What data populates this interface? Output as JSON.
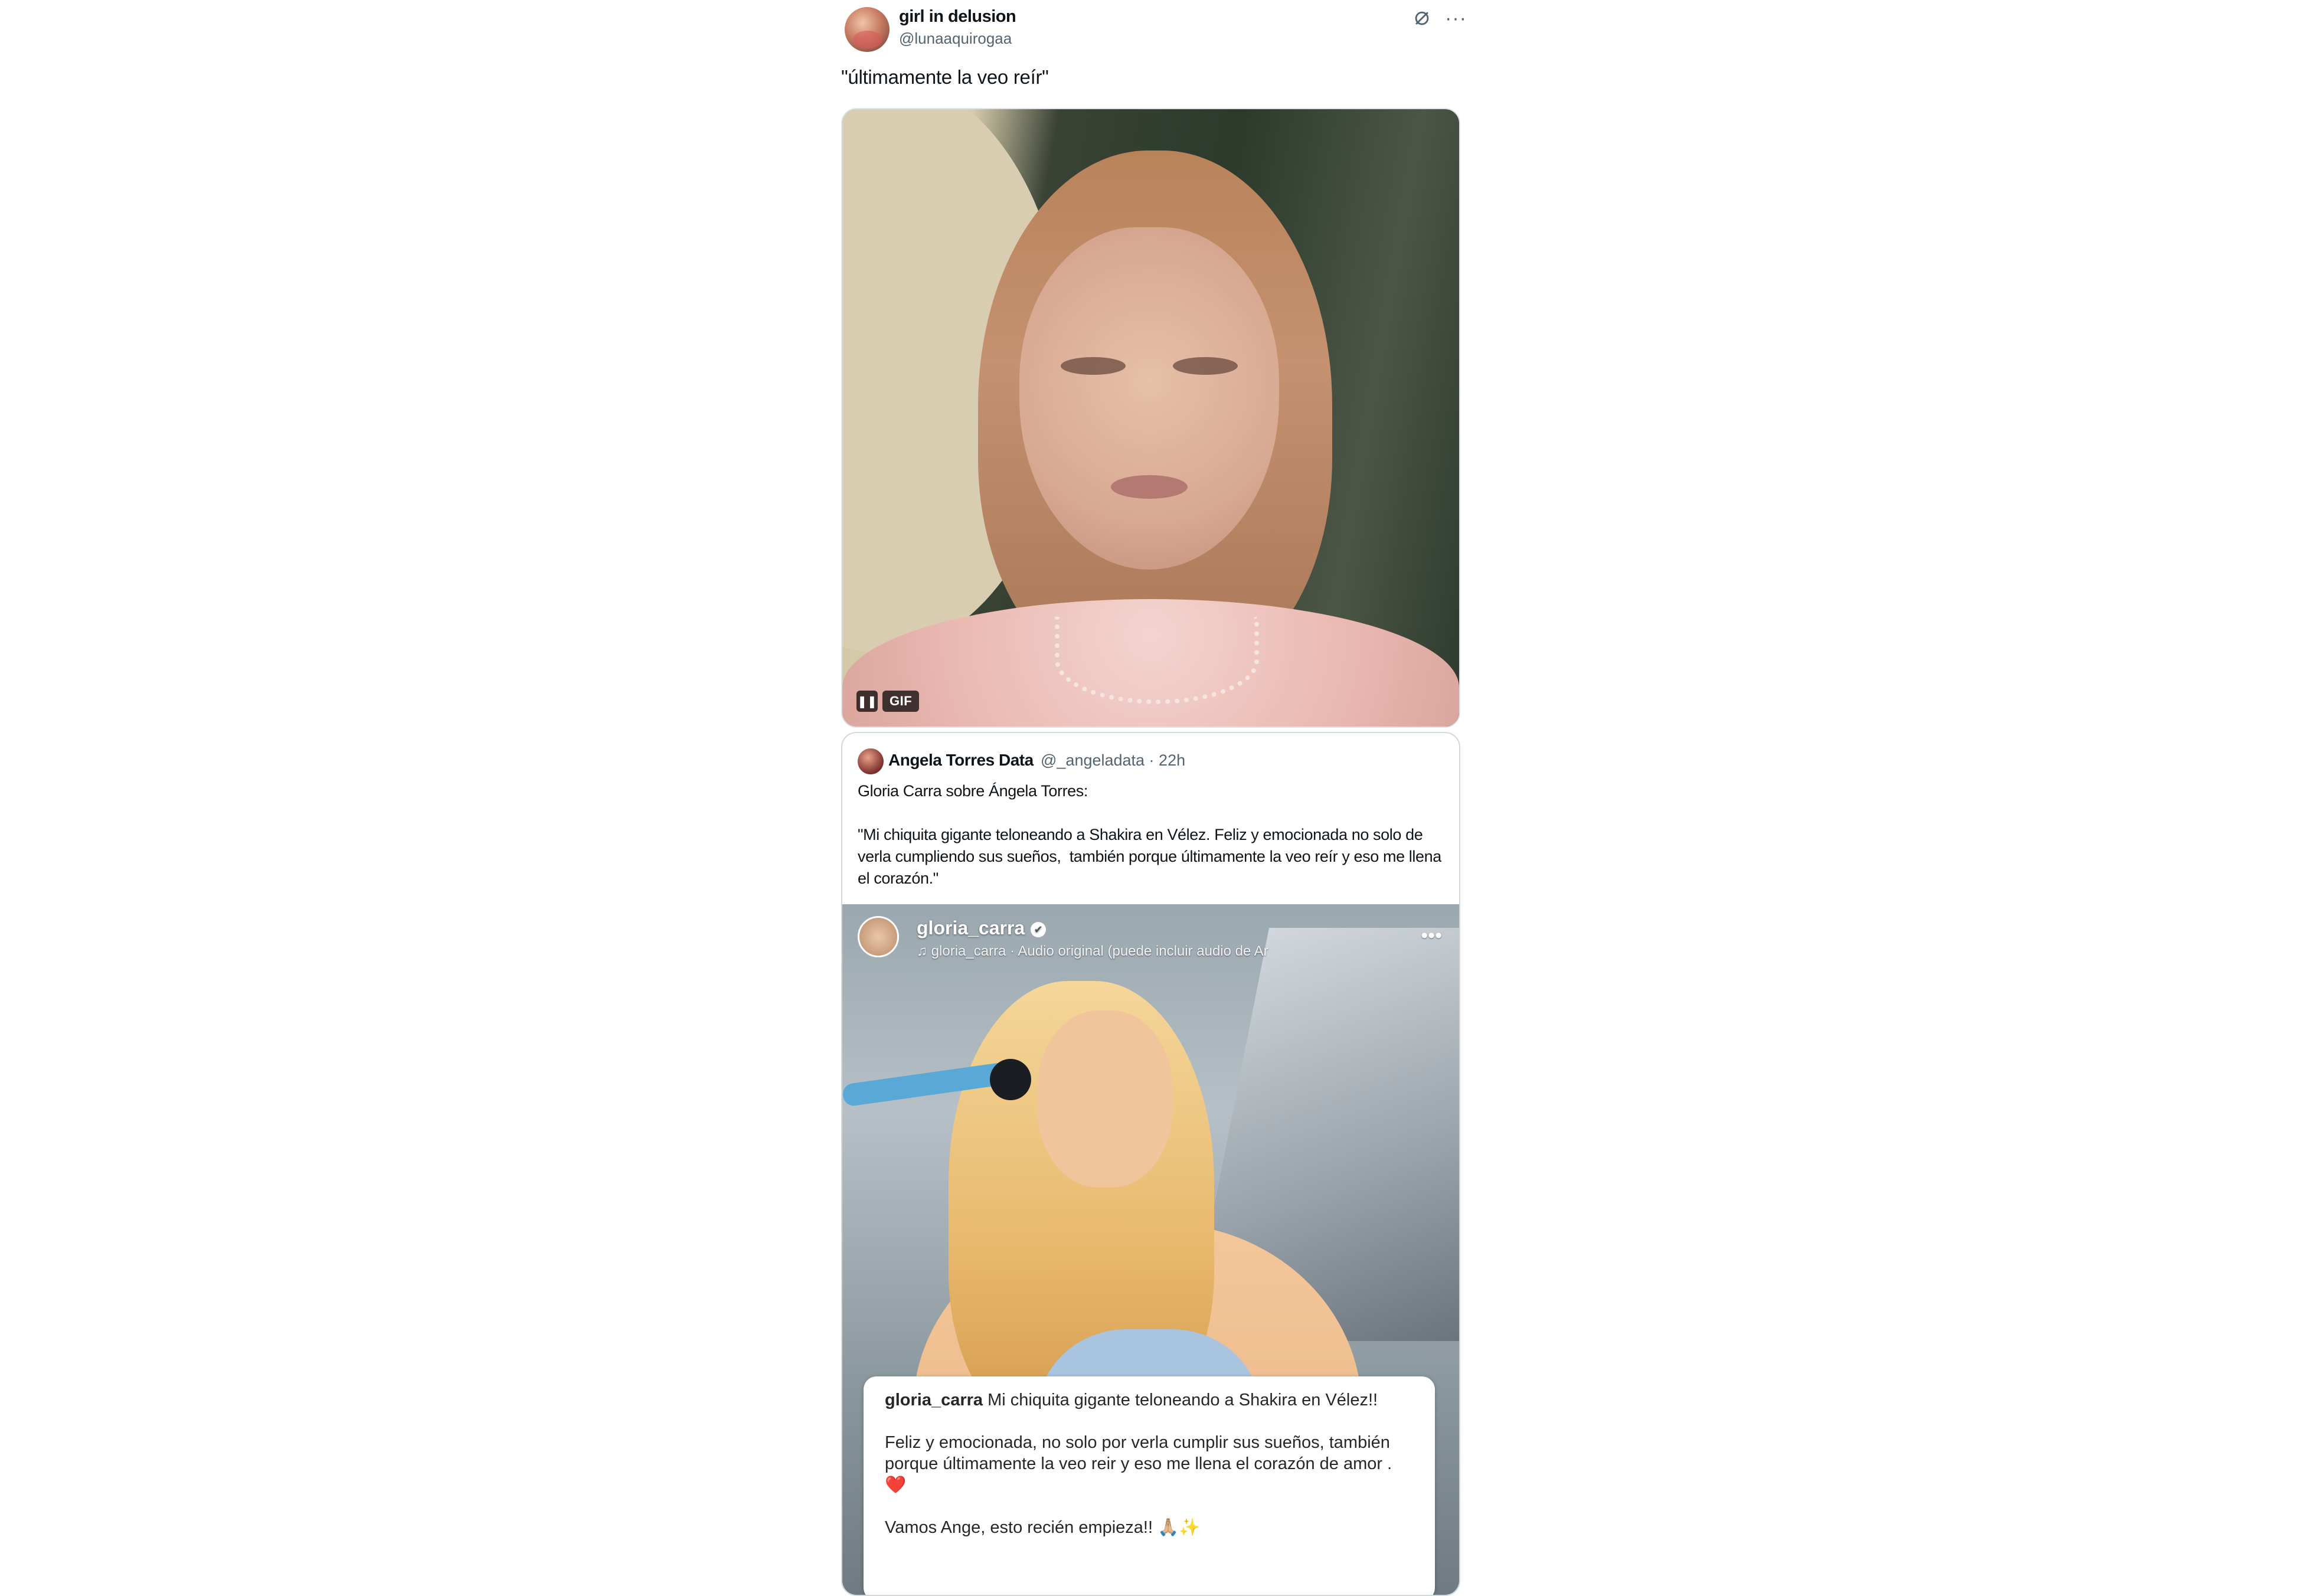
{
  "tweet": {
    "display_name": "girl in delusion",
    "handle": "@lunaaquirogaa",
    "text": "\"últimamente la veo reír\"",
    "icons": {
      "grok": "grok-icon",
      "more": "more-icon"
    },
    "media": {
      "pause_icon": "pause-icon",
      "gif_label": "GIF"
    }
  },
  "quote": {
    "author_name": "Angela Torres Data",
    "meta": "@_angeladata · 22h",
    "text": "Gloria Carra sobre Ángela Torres:\n\n\"Mi chiquita gigante teloneando a Shakira en Vélez. Feliz y emocionada no solo de verla cumpliendo sus sueños,  también porque últimamente la veo reír y eso me llena el corazón.\"",
    "ig": {
      "username": "gloria_carra",
      "verified_mark": "✔",
      "audio": "♫ gloria_carra · Audio original  (puede incluir audio de Ar",
      "more": "•••",
      "caption_user": "gloria_carra",
      "caption_text": " Mi chiquita gigante teloneando a Shakira en Vélez!!\n\nFeliz y emocionada, no solo por verla cumplir sus sueños, también porque últimamente la veo reir y eso me llena el corazón de amor . ❤️\n\nVamos Ange, esto recién empieza!! 🙏🏼✨"
    }
  },
  "colors": {
    "text_primary": "#0f1419",
    "text_secondary": "#536471",
    "border": "#cfd9de"
  }
}
